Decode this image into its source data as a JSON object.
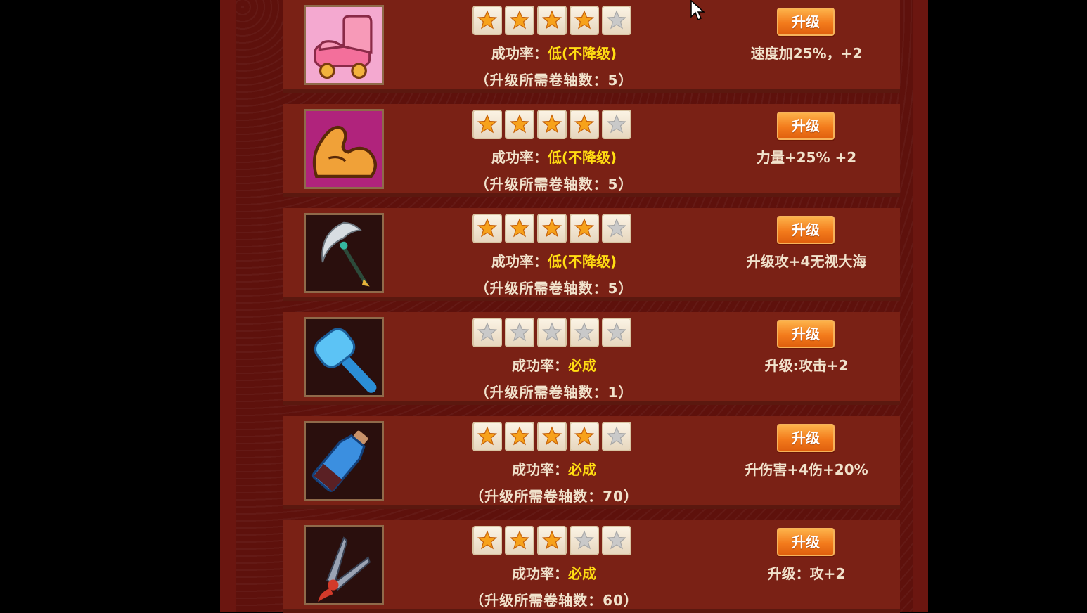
{
  "rate_label": "成功率：",
  "upgrade_label": "升级",
  "colors": {
    "star_on": "#f7a21b",
    "star_off": "#c9c9c9",
    "accent": "#ffdc12"
  },
  "items": [
    {
      "icon": "pink-boot-icon",
      "stars": 4,
      "rate": "低(不降级)",
      "scrolls": "（升级所需卷轴数：5）",
      "effect": "速度加25%，+2"
    },
    {
      "icon": "muscle-arm-icon",
      "stars": 4,
      "rate": "低(不降级)",
      "scrolls": "（升级所需卷轴数：5）",
      "effect": "力量+25% +2"
    },
    {
      "icon": "scythe-icon",
      "stars": 4,
      "rate": "低(不降级)",
      "scrolls": "（升级所需卷轴数：5）",
      "effect": "升级攻+4无视大海"
    },
    {
      "icon": "ice-hammer-icon",
      "stars": 0,
      "rate": "必成",
      "scrolls": "（升级所需卷轴数：1）",
      "effect": "升级:攻击+2"
    },
    {
      "icon": "cola-bottle-icon",
      "stars": 4,
      "rate": "必成",
      "scrolls": "（升级所需卷轴数：70）",
      "effect": "升伤害+4伤+20%"
    },
    {
      "icon": "twin-daggers-icon",
      "stars": 3,
      "rate": "必成",
      "scrolls": "（升级所需卷轴数：60）",
      "effect": "升级：攻+2"
    }
  ]
}
